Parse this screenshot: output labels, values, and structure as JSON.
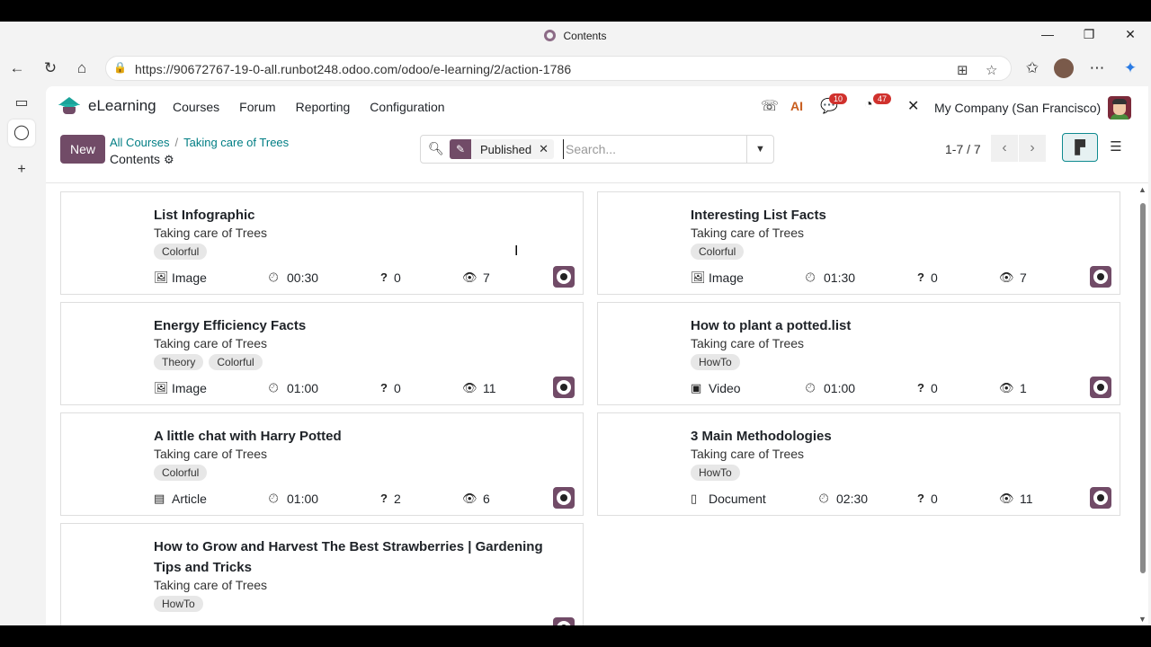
{
  "browser": {
    "window_title": "Contents",
    "url": "https://90672767-19-0-all.runbot248.odoo.com/odoo/e-learning/2/action-1786"
  },
  "app": {
    "name": "eLearning",
    "menu": [
      "Courses",
      "Forum",
      "Reporting",
      "Configuration"
    ],
    "chat_badge": "10",
    "activity_badge": "47",
    "company": "My Company (San Francisco)"
  },
  "control_panel": {
    "new_label": "New",
    "breadcrumb_1": "All Courses",
    "breadcrumb_2": "Taking care of Trees",
    "current": "Contents",
    "facet": "Published",
    "search_placeholder": "Search...",
    "pager": "1-7 / 7"
  },
  "cards": [
    {
      "title": "List Infographic",
      "course": "Taking care of Trees",
      "tags": [
        "Colorful"
      ],
      "type": "Image",
      "duration": "00:30",
      "questions": "0",
      "views": "7"
    },
    {
      "title": "Interesting List Facts",
      "course": "Taking care of Trees",
      "tags": [
        "Colorful"
      ],
      "type": "Image",
      "duration": "01:30",
      "questions": "0",
      "views": "7"
    },
    {
      "title": "Energy Efficiency Facts",
      "course": "Taking care of Trees",
      "tags": [
        "Theory",
        "Colorful"
      ],
      "type": "Image",
      "duration": "01:00",
      "questions": "0",
      "views": "11"
    },
    {
      "title": "How to plant a potted.list",
      "course": "Taking care of Trees",
      "tags": [
        "HowTo"
      ],
      "type": "Video",
      "duration": "01:00",
      "questions": "0",
      "views": "1"
    },
    {
      "title": "A little chat with Harry Potted",
      "course": "Taking care of Trees",
      "tags": [
        "Colorful"
      ],
      "type": "Article",
      "duration": "01:00",
      "questions": "2",
      "views": "6"
    },
    {
      "title": "3 Main Methodologies",
      "course": "Taking care of Trees",
      "tags": [
        "HowTo"
      ],
      "type": "Document",
      "duration": "02:30",
      "questions": "0",
      "views": "11"
    },
    {
      "title": "How to Grow and Harvest The Best Strawberries | Gardening Tips and Tricks",
      "course": "Taking care of Trees",
      "tags": [
        "HowTo"
      ]
    }
  ],
  "colors": {
    "brand": "#714b67",
    "link": "#017e84"
  }
}
